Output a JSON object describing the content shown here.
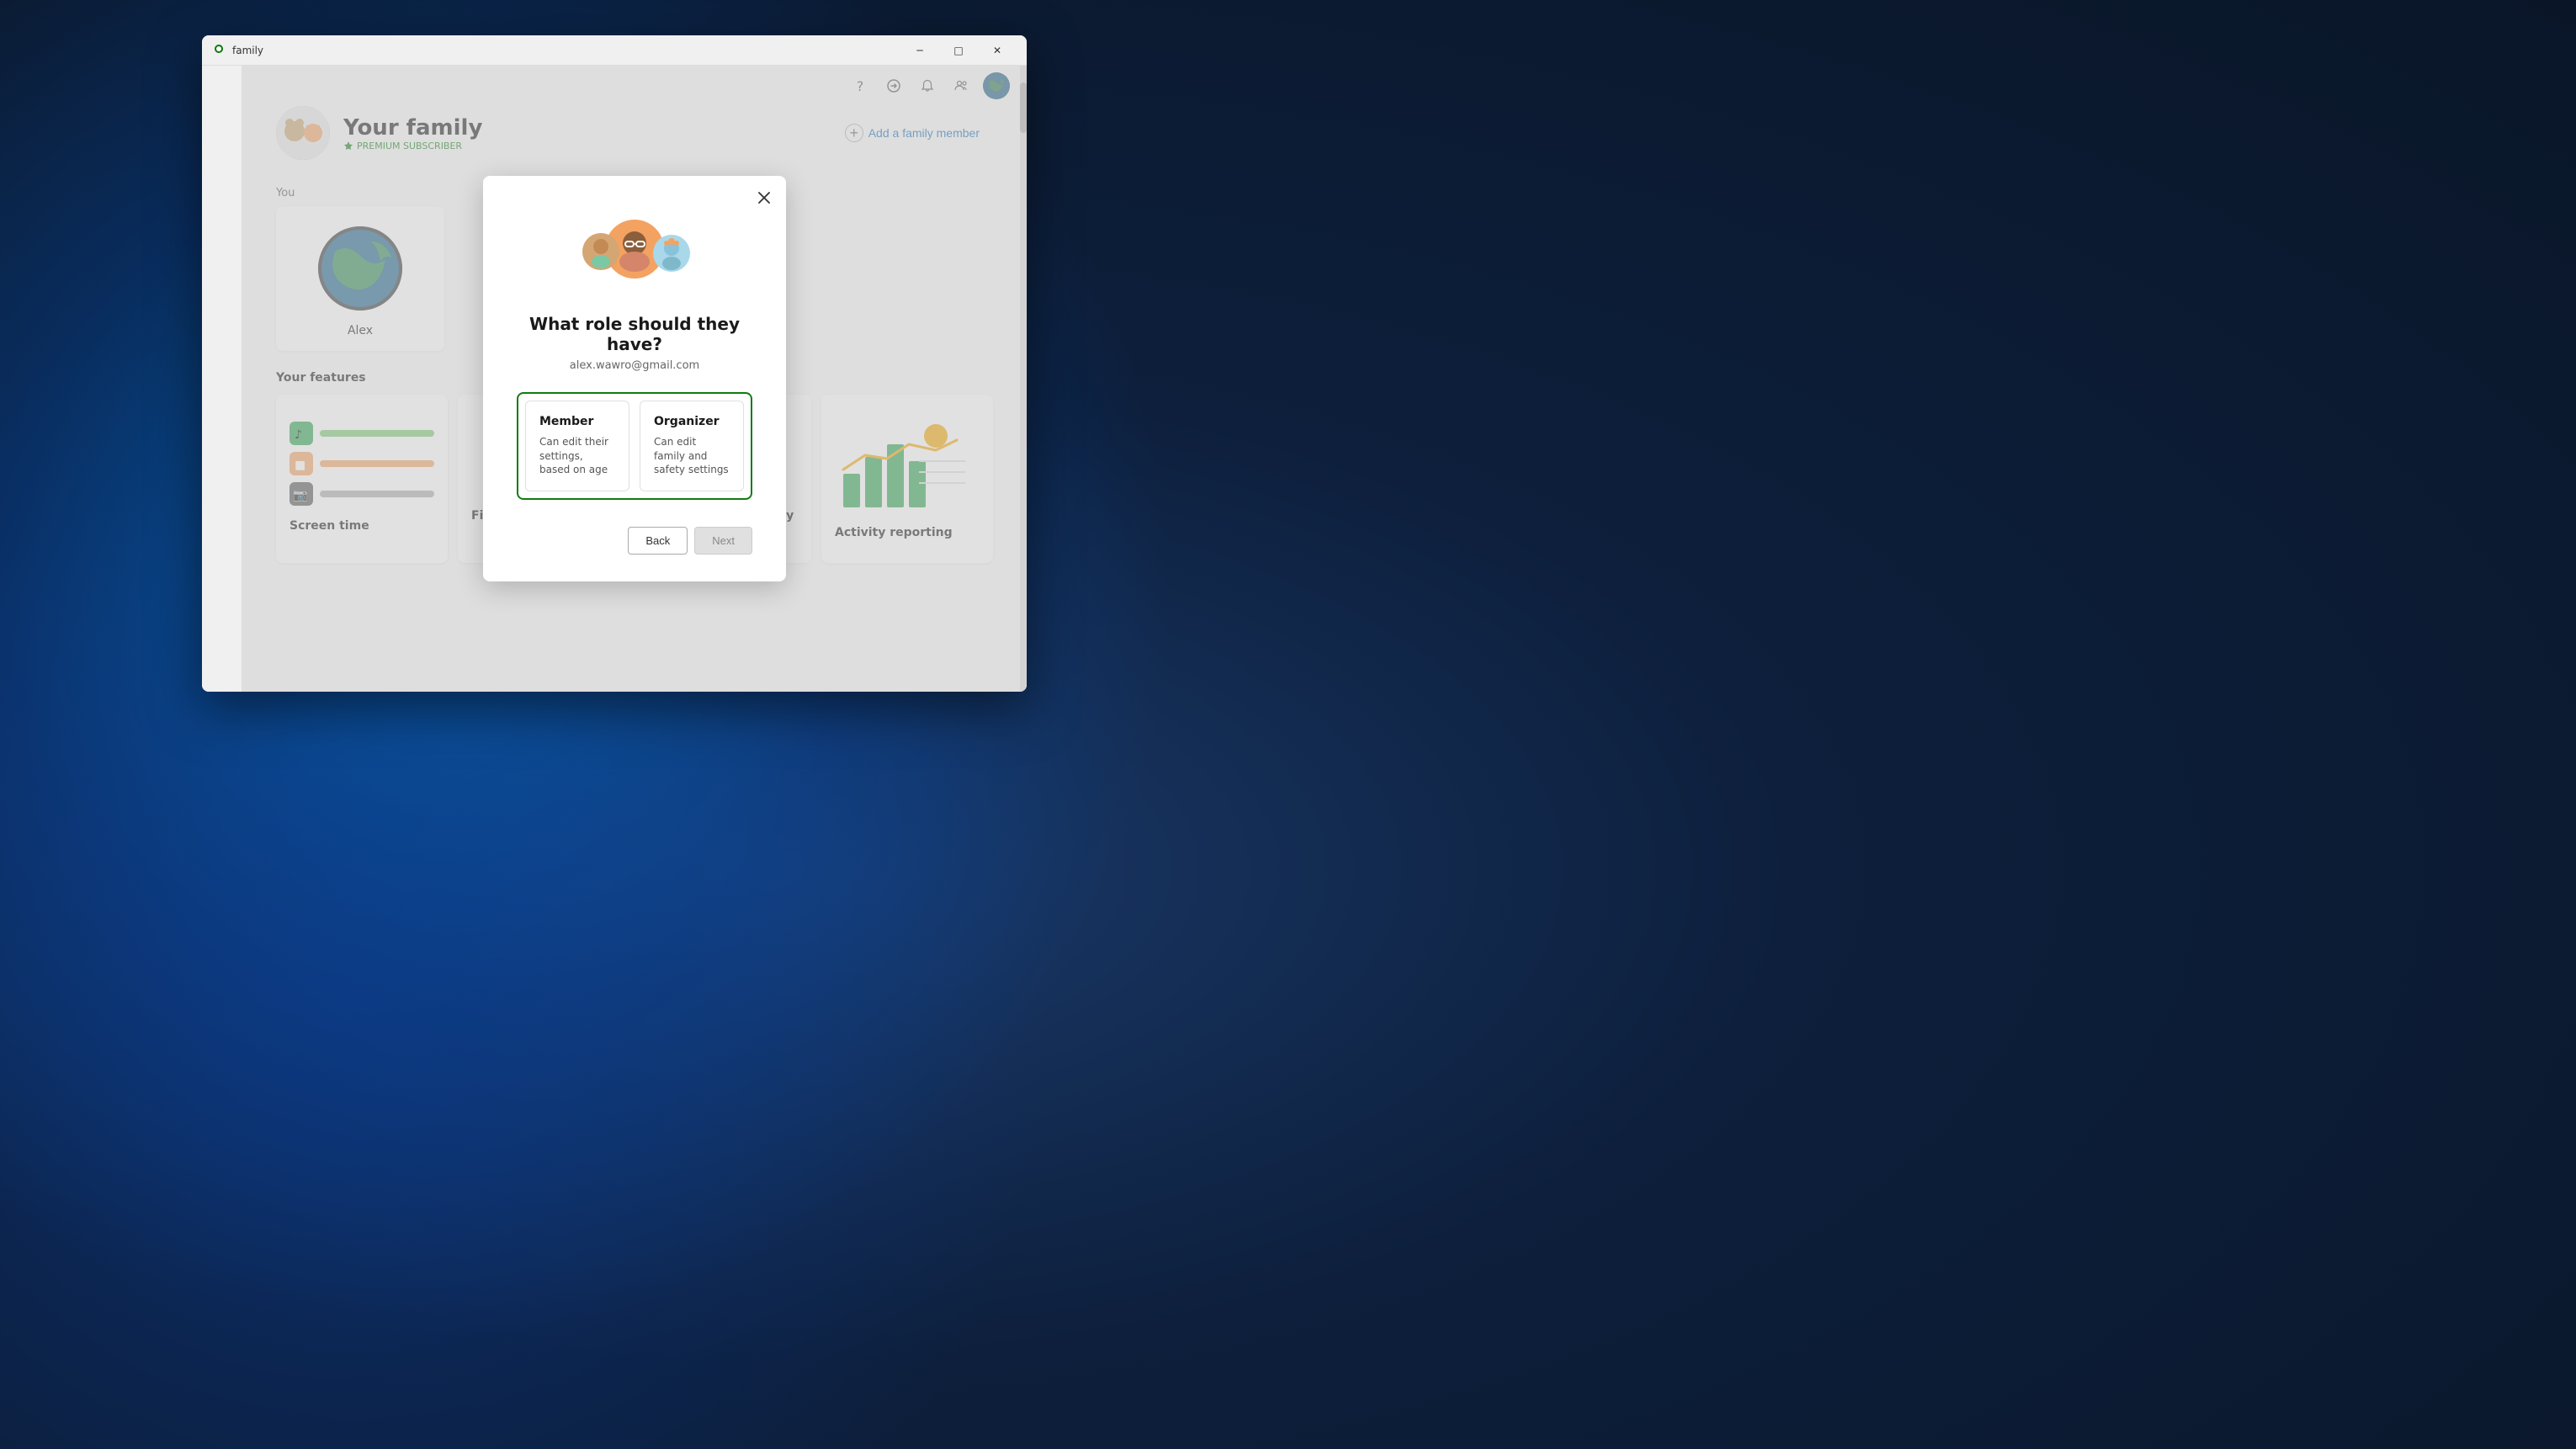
{
  "app": {
    "window_title": "family",
    "title_icon_color": "#107c10"
  },
  "title_bar": {
    "minimize_label": "─",
    "maximize_label": "□",
    "close_label": "✕"
  },
  "toolbar": {
    "help_icon": "?",
    "share_icon": "⤴",
    "notification_icon": "🔔",
    "people_icon": "👥"
  },
  "family_header": {
    "title": "Your family",
    "subtitle": "PREMIUM SUBSCRIBER",
    "add_member_label": "Add a family member"
  },
  "member": {
    "you_label": "You",
    "name": "Alex"
  },
  "features": {
    "section_title": "Your features",
    "cards": [
      {
        "id": "screen-time",
        "title": "Screen time",
        "accent_color": "#2da44e"
      },
      {
        "id": "find-family",
        "title": "Find your family",
        "accent_color": "#0078d4"
      },
      {
        "id": "safety-app",
        "title": "Try the Family Safety app",
        "accent_color": "#0078d4"
      },
      {
        "id": "activity-reporting",
        "title": "Activity reporting",
        "accent_color": "#f7a600"
      }
    ]
  },
  "modal": {
    "title": "What role should they have?",
    "email": "alex.wawro@gmail.com",
    "roles": [
      {
        "id": "member",
        "name": "Member",
        "description": "Can edit their settings, based on age"
      },
      {
        "id": "organizer",
        "name": "Organizer",
        "description": "Can edit family and safety settings"
      }
    ],
    "back_label": "Back",
    "next_label": "Next"
  }
}
